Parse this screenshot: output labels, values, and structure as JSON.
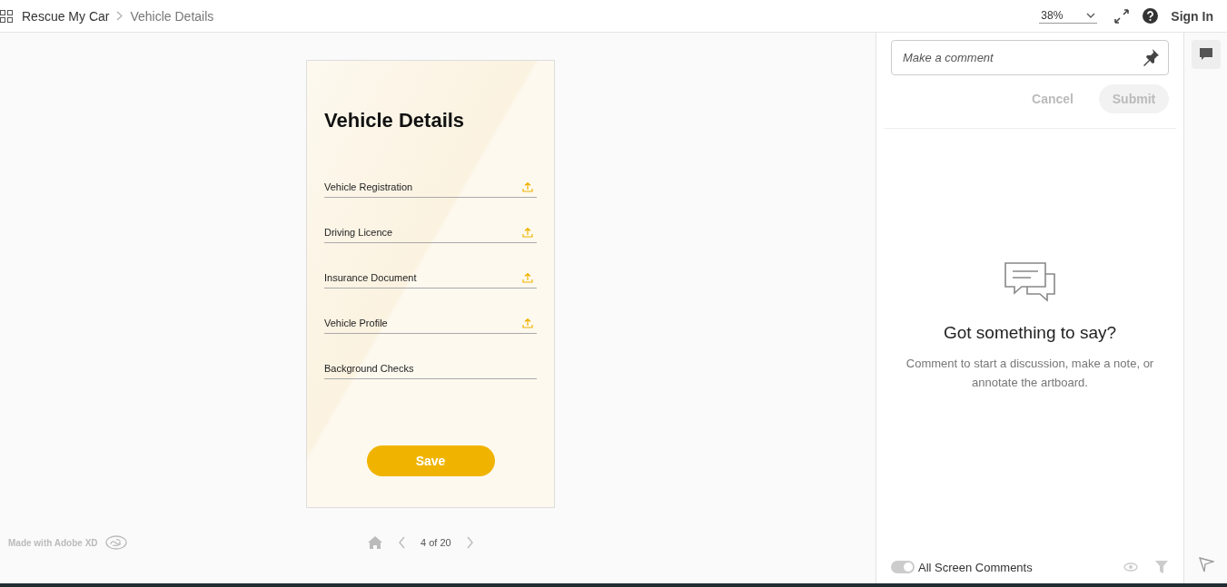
{
  "header": {
    "breadcrumb": [
      "Rescue My Car",
      "Vehicle Details"
    ],
    "zoom": "38%",
    "sign_in": "Sign In"
  },
  "artboard": {
    "title": "Vehicle Details",
    "fields": [
      {
        "label": "Vehicle Registration",
        "upload": true
      },
      {
        "label": "Driving Licence",
        "upload": true
      },
      {
        "label": "Insurance Document",
        "upload": true
      },
      {
        "label": "Vehicle Profile",
        "upload": true
      },
      {
        "label": "Background Checks",
        "upload": false
      }
    ],
    "button": "Save"
  },
  "footer": {
    "made_with": "Made with Adobe XD",
    "page": "4 of 20"
  },
  "comments": {
    "placeholder": "Make a comment",
    "cancel": "Cancel",
    "submit": "Submit",
    "empty_title": "Got something to say?",
    "empty_text": "Comment to start a discussion, make a note, or annotate the artboard.",
    "toggle": {
      "label": "All Screen Comments",
      "on": true
    }
  }
}
